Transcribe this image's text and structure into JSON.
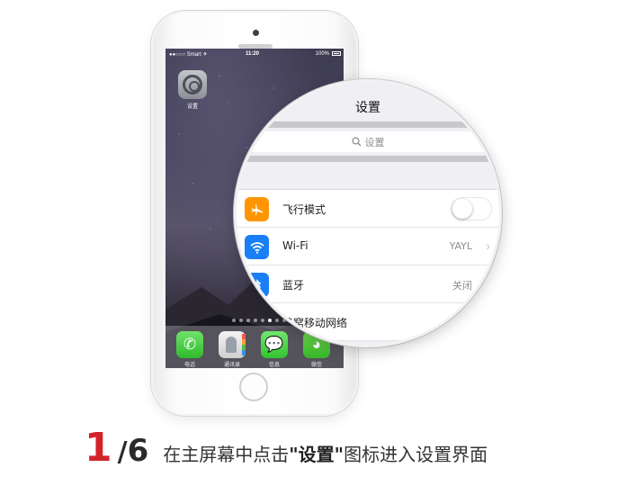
{
  "phone": {
    "status": {
      "carrier": "●●○○○ Smart ✈",
      "time": "11:20",
      "battery": "100%"
    },
    "home_apps": [
      {
        "label": "设置",
        "icon": "settings-gear-icon"
      }
    ],
    "dock": [
      {
        "label": "电话",
        "icon": "phone-icon"
      },
      {
        "label": "通讯录",
        "icon": "contacts-icon"
      },
      {
        "label": "信息",
        "icon": "messages-icon"
      },
      {
        "label": "微信",
        "icon": "wechat-icon"
      }
    ]
  },
  "magnifier": {
    "nav_title": "设置",
    "search_placeholder": "设置",
    "rows": [
      {
        "label": "飞行模式",
        "icon": "airplane-icon",
        "toggle_on": false
      },
      {
        "label": "Wi-Fi",
        "icon": "wifi-icon",
        "value": "YAYL"
      },
      {
        "label": "蓝牙",
        "icon": "bluetooth-icon",
        "value": "关闭"
      },
      {
        "label": "蜂窝移动网络"
      }
    ]
  },
  "caption": {
    "step_current": "1",
    "step_sep": "/",
    "step_total": "6",
    "text_before": "在主屏幕中点击",
    "highlight": "\"设置\"",
    "text_after": "图标进入设置界面"
  },
  "colors": {
    "step_accent": "#d4222b",
    "airplane": "#ff9500",
    "wifi": "#1a7ef7",
    "bluetooth": "#1a7ef7"
  }
}
